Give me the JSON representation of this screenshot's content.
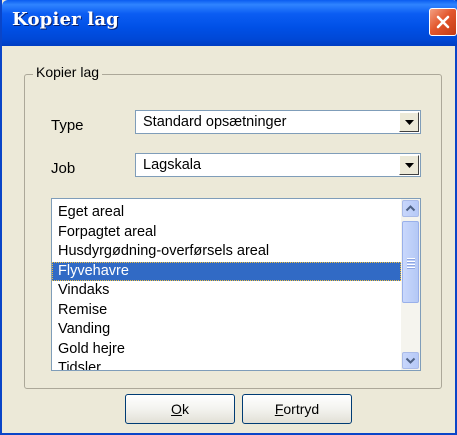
{
  "window": {
    "title": "Kopier lag"
  },
  "group": {
    "legend": "Kopier lag"
  },
  "type_field": {
    "label": "Type",
    "value": "Standard opsætninger"
  },
  "job_field": {
    "label": "Job",
    "value": "Lagskala"
  },
  "list": {
    "items": [
      "Eget areal",
      "Forpagtet areal",
      "Husdyrgødning-overførsels areal",
      "Flyvehavre",
      "Vindaks",
      "Remise",
      "Vanding",
      "Gold hejre",
      "Tidsler"
    ],
    "selected": "Flyvehavre"
  },
  "buttons": {
    "ok_accel": "O",
    "ok_rest": "k",
    "cancel_accel": "F",
    "cancel_rest": "ortryd"
  },
  "colors": {
    "titlebar": "#0050e6",
    "selection": "#316ac5",
    "face": "#ece9d8"
  }
}
